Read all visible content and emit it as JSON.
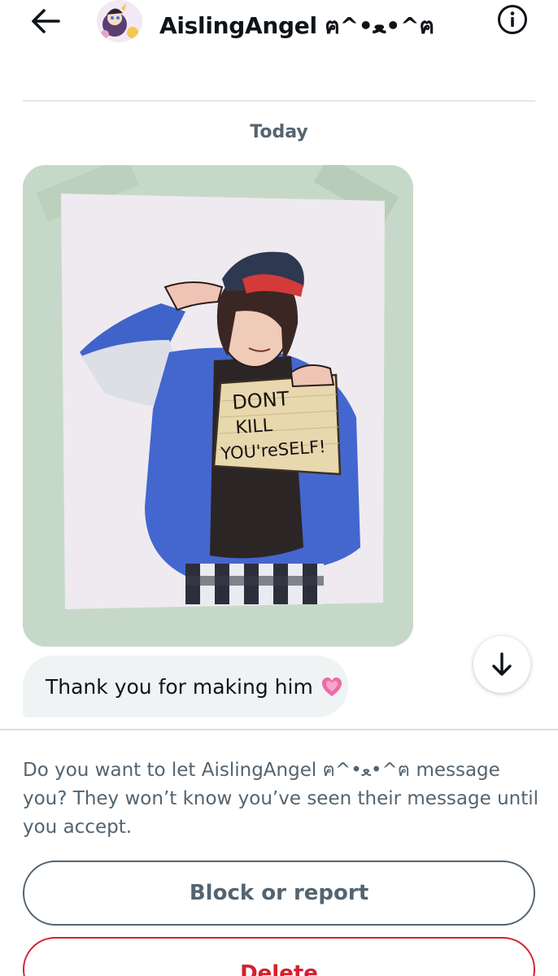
{
  "header": {
    "title": "AislingAngel ฅ^•ﻌ•^ฅ",
    "back_icon": "arrow-left-icon",
    "info_icon": "info-circle-icon"
  },
  "conversation": {
    "date_label": "Today",
    "image_sign_text": [
      "DONT",
      "KILL",
      "YOU'reSELF!"
    ],
    "message_text": "Thank you for making him",
    "message_emoji": "growing-heart-emoji",
    "scroll_icon": "arrow-down-icon"
  },
  "request": {
    "prompt": "Do you want to let AislingAngel ฅ^•ﻌ•^ฅ message you? They won’t know you’ve seen their message until you accept.",
    "block_label": "Block or report",
    "delete_label": "Delete"
  },
  "colors": {
    "accent_red": "#d4202e",
    "secondary_text": "#536471",
    "bubble_bg": "#eff3f4"
  }
}
